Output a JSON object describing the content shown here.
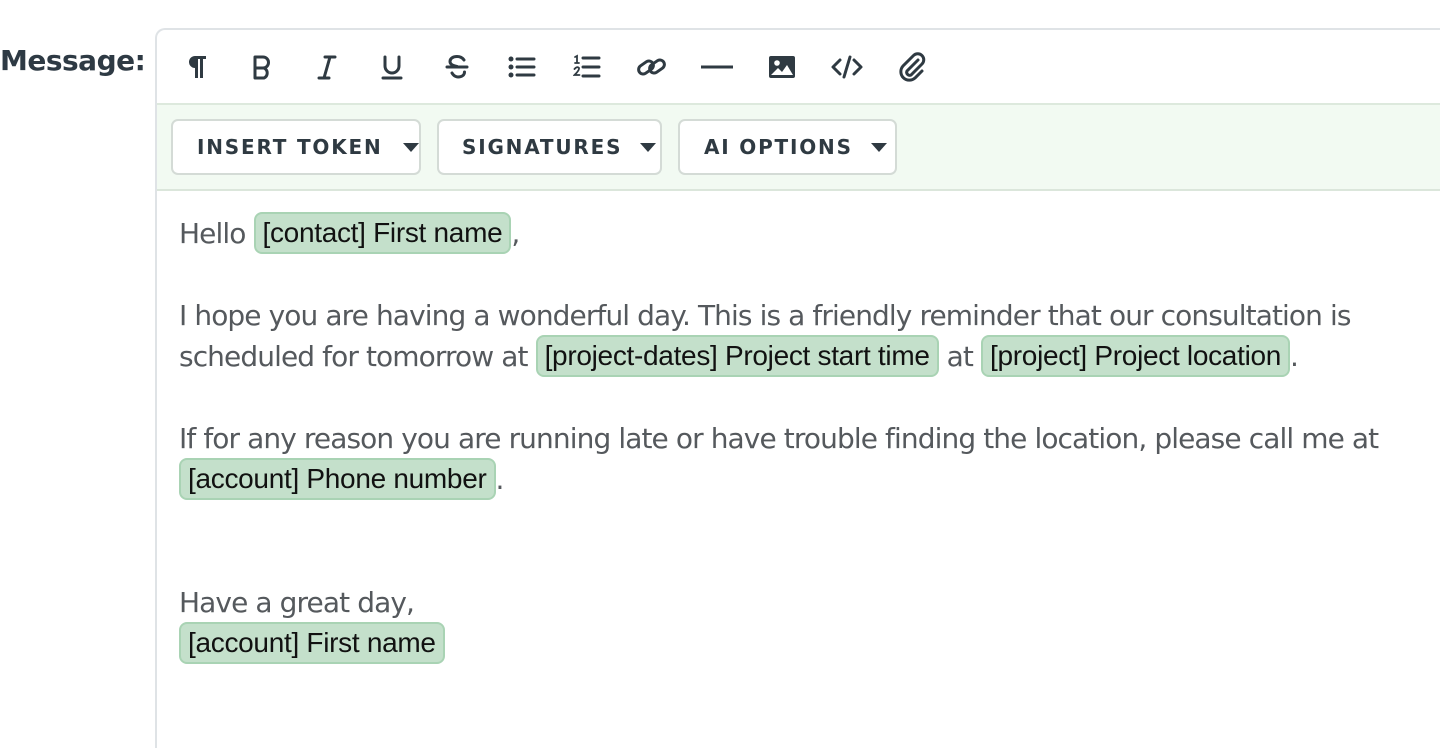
{
  "field_label": "Message:",
  "toolbar": {
    "tools": [
      {
        "name": "paragraph-icon"
      },
      {
        "name": "bold-icon"
      },
      {
        "name": "italic-icon"
      },
      {
        "name": "underline-icon"
      },
      {
        "name": "strikethrough-icon"
      },
      {
        "name": "bullet-list-icon"
      },
      {
        "name": "numbered-list-icon"
      },
      {
        "name": "link-icon"
      },
      {
        "name": "horizontal-rule-icon"
      },
      {
        "name": "image-icon"
      },
      {
        "name": "code-icon"
      },
      {
        "name": "attachment-icon"
      }
    ]
  },
  "token_bar": {
    "insert_token": "INSERT TOKEN",
    "signatures": "SIGNATURES",
    "ai_options": "AI OPTIONS"
  },
  "message": {
    "greeting_prefix": "Hello",
    "contact_first_name_token": "[contact] First name",
    "greeting_suffix": ",",
    "para1_line1": "I hope you are having a wonderful day. This is a friendly reminder that our consultation is",
    "para1_line2_prefix": "scheduled for tomorrow at",
    "project_start_time_token": "[project-dates] Project start time",
    "para1_at": "at",
    "project_location_token": "[project] Project location",
    "para1_end": ".",
    "para2_line1": "If for any reason you are running late or have trouble finding the location, please call me at",
    "phone_token": "[account] Phone number",
    "para2_end": ".",
    "closing": "Have a great day,",
    "account_first_name_token": "[account] First name"
  },
  "colors": {
    "token_bg": "#c4e0cb",
    "token_border": "#a9d3b4",
    "token_bar_bg": "#f2faf2",
    "text": "#55595d",
    "icon": "#2f3a42"
  }
}
